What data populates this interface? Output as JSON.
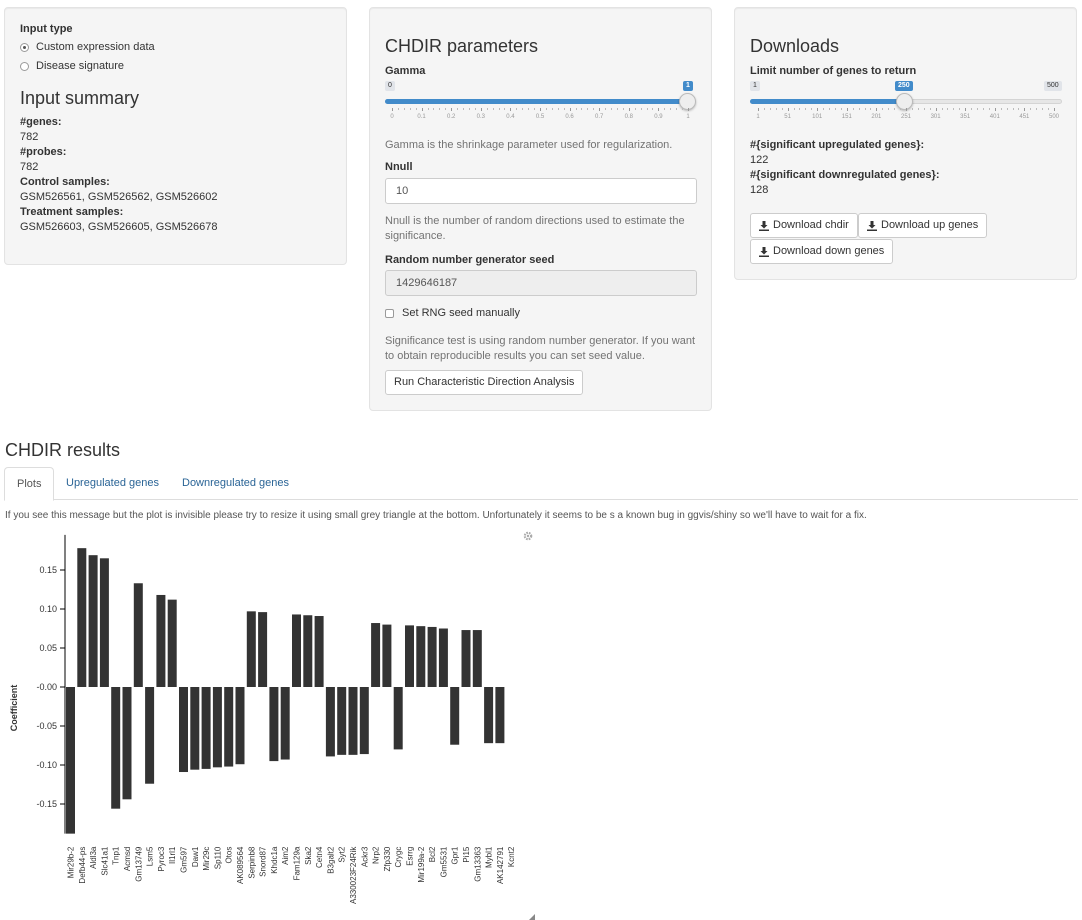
{
  "input_panel": {
    "input_type_label": "Input type",
    "radio_options": [
      {
        "label": "Custom expression data",
        "selected": true
      },
      {
        "label": "Disease signature",
        "selected": false
      }
    ],
    "summary_title": "Input summary",
    "genes_label": "#genes:",
    "genes_value": "782",
    "probes_label": "#probes:",
    "probes_value": "782",
    "control_label": "Control samples:",
    "control_value": "GSM526561, GSM526562, GSM526602",
    "treatment_label": "Treatment samples:",
    "treatment_value": "GSM526603, GSM526605, GSM526678"
  },
  "chdir_panel": {
    "title": "CHDIR parameters",
    "gamma_label": "Gamma",
    "gamma_slider": {
      "min": "0",
      "max": "1",
      "value": "1",
      "fraction": 1.0,
      "ticks": [
        "0",
        "0.1",
        "0.2",
        "0.3",
        "0.4",
        "0.5",
        "0.6",
        "0.7",
        "0.8",
        "0.9",
        "1"
      ]
    },
    "gamma_help": "Gamma is the shrinkage parameter used for regularization.",
    "nnull_label": "Nnull",
    "nnull_value": "10",
    "nnull_help": "Nnull is the number of random directions used to estimate the significance.",
    "seed_label": "Random number generator seed",
    "seed_value": "1429646187",
    "set_seed_label": "Set RNG seed manually",
    "set_seed_checked": false,
    "significance_help": "Significance test is using random number generator. If you want to obtain reproducible results you can set seed value.",
    "run_button": "Run Characteristic Direction Analysis"
  },
  "downloads_panel": {
    "title": "Downloads",
    "limit_label": "Limit number of genes to return",
    "limit_slider": {
      "min": "1",
      "max": "500",
      "value": "250",
      "fraction": 0.499,
      "ticks": [
        "1",
        "51",
        "101",
        "151",
        "201",
        "251",
        "301",
        "351",
        "401",
        "451",
        "500"
      ]
    },
    "up_label": "#{significant upregulated genes}:",
    "up_value": "122",
    "down_label": "#{significant downregulated genes}:",
    "down_value": "128",
    "btn_chdir": "Download chdir",
    "btn_up": "Download up genes",
    "btn_down": "Download down genes"
  },
  "results": {
    "title": "CHDIR results",
    "tabs": [
      "Plots",
      "Upregulated genes",
      "Downregulated genes"
    ],
    "active_tab": "Plots",
    "message": "If you see this message but the plot is invisible please try to resize it using small grey triangle at the bottom. Unfortunately it seems to be s a known bug in ggvis/shiny so we'll have to wait for a fix."
  },
  "colors": {
    "bar": "#333333",
    "accent": "#428bca",
    "link": "#2a6496",
    "panel_bg": "#f5f5f5"
  },
  "icons": {
    "gear": "gear-icon",
    "download": "download-icon",
    "resize": "resize-handle-icon"
  },
  "chart_data": {
    "type": "bar",
    "xlabel": "",
    "ylabel": "Coefficient",
    "ylim": [
      -0.188,
      0.195
    ],
    "yticks": [
      "0.15",
      "0.10",
      "0.05",
      "-0.00",
      "-0.05",
      "-0.10",
      "-0.15"
    ],
    "ytick_values": [
      0.15,
      0.1,
      0.05,
      0.0,
      -0.05,
      -0.1,
      -0.15
    ],
    "categories": [
      "Mir29b-2",
      "Defb44-ps",
      "Aldl3a",
      "Slc41a1",
      "Tnp1",
      "Acmsd",
      "Gm13749",
      "Lsm5",
      "Pyroc3",
      "Il1rl1",
      "Gm597",
      "Daw1",
      "Mir29c",
      "Sp110",
      "Otos",
      "AK089564",
      "Serpinb8",
      "Snord87",
      "Khdc1a",
      "Aim2",
      "Fam129a",
      "Ska2",
      "Cetn4",
      "B3galt2",
      "Syt2",
      "A330023F24Rik",
      "Ackr3",
      "Nrp2",
      "Zfp330",
      "Crygc",
      "Esrrg",
      "Mir199a-2",
      "Bcl2",
      "Gm5531",
      "Gpr1",
      "Pi15",
      "Gm13363",
      "Mybl1",
      "AK142791",
      "Kcnt2"
    ],
    "values": [
      -0.188,
      0.178,
      0.169,
      0.165,
      -0.156,
      -0.144,
      0.133,
      -0.124,
      0.118,
      0.112,
      -0.109,
      -0.106,
      -0.105,
      -0.103,
      -0.102,
      -0.099,
      0.097,
      0.096,
      -0.095,
      -0.093,
      0.093,
      0.092,
      0.091,
      -0.089,
      -0.087,
      -0.087,
      -0.086,
      0.082,
      0.08,
      -0.08,
      0.079,
      0.078,
      0.077,
      0.075,
      -0.074,
      0.073,
      0.073,
      -0.072,
      -0.072,
      0
    ]
  }
}
